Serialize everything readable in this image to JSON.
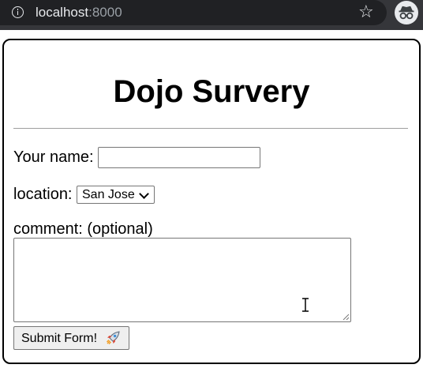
{
  "browser": {
    "url_host": "localhost",
    "url_port": ":8000",
    "star_glyph": "☆",
    "icons": [
      "info-icon",
      "bookmark-star-icon",
      "incognito-icon"
    ]
  },
  "page": {
    "title": "Dojo Survery",
    "name_label": "Your name:",
    "name_value": "",
    "location_label": "location:",
    "location_selected": "San Jose",
    "comment_label": "comment: (optional)",
    "comment_value": "",
    "submit_label": "Submit Form!",
    "icons": [
      "chevron-down-icon",
      "resize-handle-icon",
      "text-cursor-icon",
      "rocket-icon"
    ]
  }
}
